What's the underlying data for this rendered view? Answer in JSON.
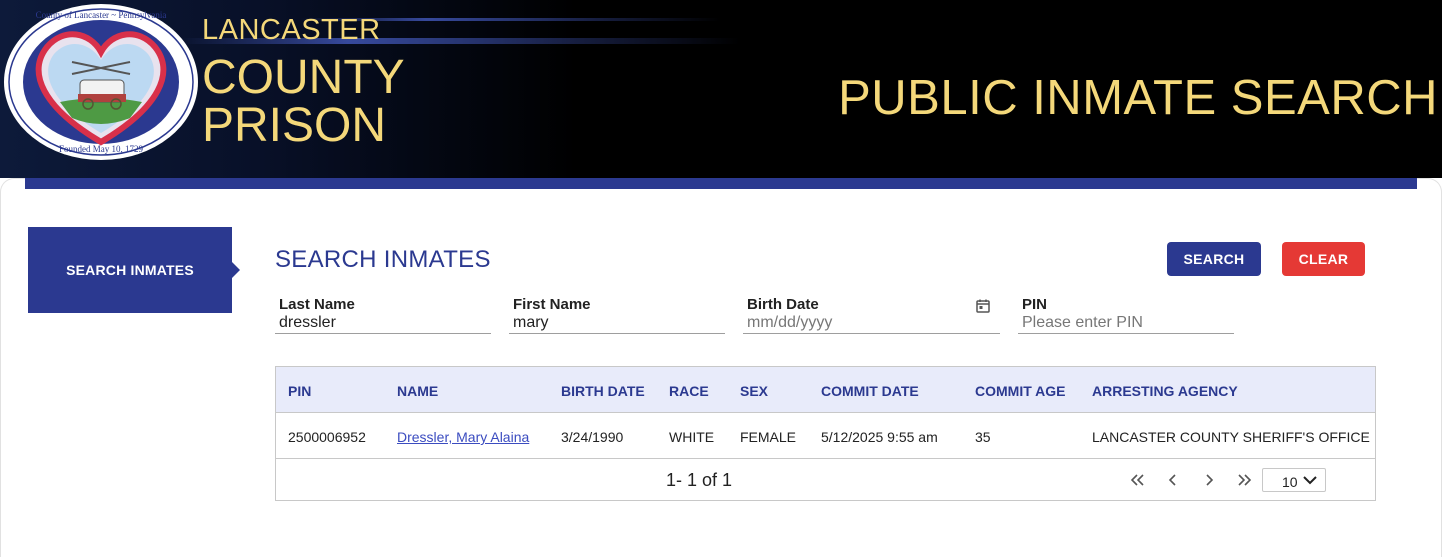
{
  "header": {
    "county": "LANCASTER",
    "prison_line1": "COUNTY",
    "prison_line2": "PRISON",
    "page_title": "PUBLIC INMATE SEARCH",
    "seal": {
      "top_text": "County of Lancaster ~ Pennsylvania",
      "bottom_text": "Founded May 10, 1729"
    }
  },
  "sidebar": {
    "items": [
      {
        "label": "SEARCH INMATES"
      }
    ]
  },
  "search": {
    "title": "SEARCH INMATES",
    "search_label": "SEARCH",
    "clear_label": "CLEAR",
    "fields": {
      "last_name": {
        "label": "Last Name",
        "value": "dressler"
      },
      "first_name": {
        "label": "First Name",
        "value": "mary"
      },
      "birth_date": {
        "label": "Birth Date",
        "placeholder": "mm/dd/yyyy"
      },
      "pin": {
        "label": "PIN",
        "placeholder": "Please enter PIN"
      }
    }
  },
  "table": {
    "columns": [
      "PIN",
      "NAME",
      "BIRTH DATE",
      "RACE",
      "SEX",
      "COMMIT DATE",
      "COMMIT AGE",
      "ARRESTING AGENCY"
    ],
    "rows": [
      {
        "pin": "2500006952",
        "name": "Dressler, Mary Alaina",
        "birth_date": "3/24/1990",
        "race": "WHITE",
        "sex": "FEMALE",
        "commit_date": "5/12/2025 9:55 am",
        "commit_age": "35",
        "agency": "LANCASTER COUNTY SHERIFF'S OFFICE"
      }
    ],
    "pager": {
      "summary": "1- 1 of 1",
      "page_size": "10"
    }
  },
  "colors": {
    "brand_blue": "#2b3990",
    "clear_red": "#e53935",
    "gold": "#f4d87a",
    "header_row": "#e8ebfa"
  }
}
